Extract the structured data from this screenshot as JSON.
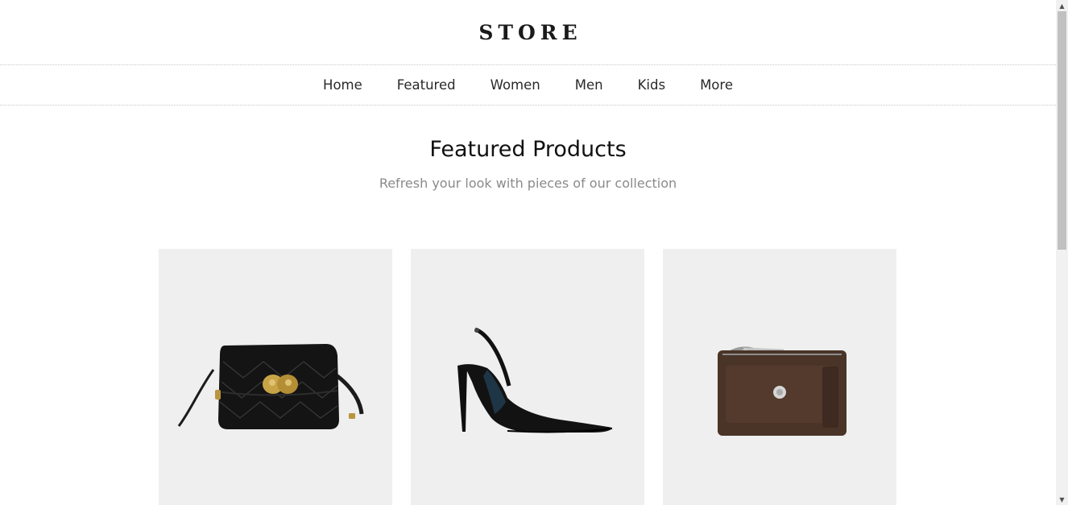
{
  "header": {
    "logo": "STORE"
  },
  "nav": {
    "items": [
      {
        "label": "Home"
      },
      {
        "label": "Featured"
      },
      {
        "label": "Women"
      },
      {
        "label": "Men"
      },
      {
        "label": "Kids"
      },
      {
        "label": "More"
      }
    ]
  },
  "section": {
    "title": "Featured Products",
    "subtitle": "Refresh your look with pieces of our collection"
  },
  "products": [
    {
      "image": "black-quilted-belt-bag"
    },
    {
      "image": "black-slingback-heel"
    },
    {
      "image": "brown-leather-card-pouch"
    }
  ],
  "colors": {
    "card_background": "#efefef",
    "subtitle_text": "#8a8a8a",
    "divider": "#c8c8c8"
  }
}
